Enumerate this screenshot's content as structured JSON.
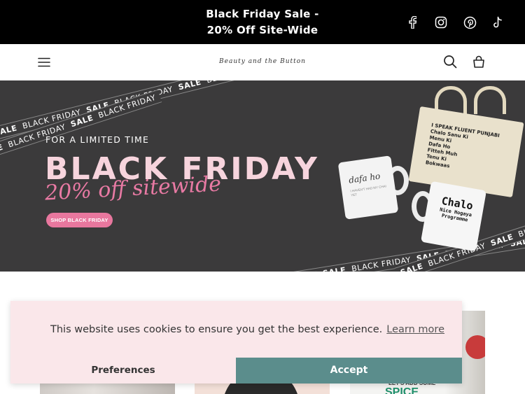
{
  "announcement": {
    "line1": "Black Friday Sale -",
    "line2": "20% Off Site-Wide"
  },
  "social_icons": [
    "facebook-icon",
    "instagram-icon",
    "pinterest-icon",
    "tiktok-icon"
  ],
  "header": {
    "logo_text": "Beauty and the Button",
    "icons": [
      "menu-icon",
      "search-icon",
      "cart-icon"
    ]
  },
  "hero": {
    "tape_words": [
      "SALE",
      "BLACK FRIDAY"
    ],
    "eyebrow": "FOR A LIMITED TIME",
    "headline": "BLACK FRIDAY",
    "subheadline": "20% off sitewide",
    "cta_label": "SHOP BLACK FRIDAY",
    "tote_lines": [
      "I SPEAK FLUENT PUNJABI",
      "Chalo Sanu Ki",
      "Menu Ki",
      "Dafa Ho",
      "Fitteh Muh",
      "Tenu Ki",
      "Bokwaas"
    ],
    "mug1_text": "dafa ho",
    "mug1_small": "I HAVEN'T HAD MY CHAI YET",
    "mug2_lines": [
      "Chalo",
      "Nice Hogaya",
      "Programme"
    ]
  },
  "cookie_banner": {
    "message": "This website uses cookies to ensure you get the best experience.",
    "learn_more": "Learn more",
    "preferences_label": "Preferences",
    "accept_label": "Accept"
  },
  "product_cards": {
    "card3_text_line1": "LET'S ADD SOME",
    "card3_text_line2": "SPICE"
  },
  "colors": {
    "announcement_bg": "#000000",
    "hero_bg": "#3b3a3b",
    "headline_pink": "#f7d4dd",
    "script_pink": "#e97aa4",
    "cta_bg": "#e8779e",
    "cookie_bg": "#fae7ea",
    "accept_bg": "#5b8d8c"
  }
}
